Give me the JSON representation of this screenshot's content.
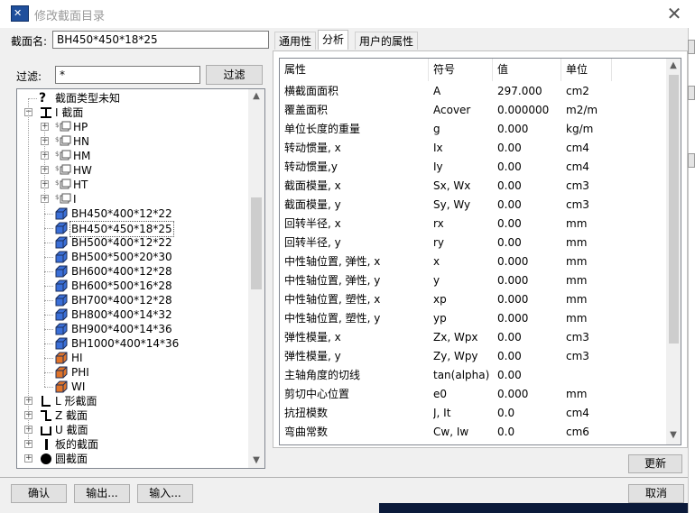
{
  "window": {
    "title": "修改截面目录",
    "close_glyph": "✕",
    "icon": "section-catalog-app-icon"
  },
  "section_name": {
    "label": "截面名:",
    "value": "BH450*450*18*25"
  },
  "filter": {
    "label": "过滤:",
    "value": "*",
    "button": "过滤"
  },
  "tree": {
    "items": [
      {
        "label": "截面类型未知",
        "icon": "question-icon"
      },
      {
        "label": "I 截面",
        "icon": "i-beam-icon",
        "expander": "−"
      },
      {
        "label": "HP",
        "icon": "profile-group-icon",
        "expander": "+"
      },
      {
        "label": "HN",
        "icon": "profile-group-icon",
        "expander": "+"
      },
      {
        "label": "HM",
        "icon": "profile-group-icon",
        "expander": "+"
      },
      {
        "label": "HW",
        "icon": "profile-group-icon",
        "expander": "+"
      },
      {
        "label": "HT",
        "icon": "profile-group-icon",
        "expander": "+"
      },
      {
        "label": "I",
        "icon": "profile-group-icon",
        "expander": "+"
      },
      {
        "label": "BH450*400*12*22",
        "icon": "blue-cube-icon"
      },
      {
        "label": "BH450*450*18*25",
        "icon": "blue-cube-icon",
        "selected": true
      },
      {
        "label": "BH500*400*12*22",
        "icon": "blue-cube-icon"
      },
      {
        "label": "BH500*500*20*30",
        "icon": "blue-cube-icon"
      },
      {
        "label": "BH600*400*12*28",
        "icon": "blue-cube-icon"
      },
      {
        "label": "BH600*500*16*28",
        "icon": "blue-cube-icon"
      },
      {
        "label": "BH700*400*12*28",
        "icon": "blue-cube-icon"
      },
      {
        "label": "BH800*400*14*32",
        "icon": "blue-cube-icon"
      },
      {
        "label": "BH900*400*14*36",
        "icon": "blue-cube-icon"
      },
      {
        "label": "BH1000*400*14*36",
        "icon": "blue-cube-icon"
      },
      {
        "label": "HI",
        "icon": "orange-cube-icon"
      },
      {
        "label": "PHI",
        "icon": "orange-cube-icon"
      },
      {
        "label": "WI",
        "icon": "orange-cube-icon"
      },
      {
        "label": "L 形截面",
        "icon": "l-section-icon",
        "expander": "+"
      },
      {
        "label": "Z 截面",
        "icon": "z-section-icon",
        "expander": "+"
      },
      {
        "label": "U 截面",
        "icon": "u-section-icon",
        "expander": "+"
      },
      {
        "label": "板的截面",
        "icon": "plate-section-icon",
        "expander": "+"
      },
      {
        "label": "圆截面",
        "icon": "round-section-icon",
        "expander": "+"
      }
    ]
  },
  "tabs": [
    {
      "label": "通用性"
    },
    {
      "label": "分析",
      "active": true
    },
    {
      "label": "用户的属性"
    }
  ],
  "grid": {
    "columns": [
      "属性",
      "符号",
      "值",
      "单位"
    ],
    "rows": [
      [
        "横截面面积",
        "A",
        "297.000",
        "cm2"
      ],
      [
        "覆盖面积",
        "Acover",
        "0.000000",
        "m2/m"
      ],
      [
        "单位长度的重量",
        "g",
        "0.000",
        "kg/m"
      ],
      [
        "转动惯量, x",
        "Ix",
        "0.00",
        "cm4"
      ],
      [
        "转动惯量,y",
        "Iy",
        "0.00",
        "cm4"
      ],
      [
        "截面模量, x",
        "Sx, Wx",
        "0.00",
        "cm3"
      ],
      [
        "截面模量, y",
        "Sy, Wy",
        "0.00",
        "cm3"
      ],
      [
        "回转半径, x",
        "rx",
        "0.00",
        "mm"
      ],
      [
        "回转半径, y",
        "ry",
        "0.00",
        "mm"
      ],
      [
        "中性轴位置, 弹性, x",
        "x",
        "0.000",
        "mm"
      ],
      [
        "中性轴位置, 弹性, y",
        "y",
        "0.000",
        "mm"
      ],
      [
        "中性轴位置, 塑性, x",
        "xp",
        "0.000",
        "mm"
      ],
      [
        "中性轴位置, 塑性, y",
        "yp",
        "0.000",
        "mm"
      ],
      [
        "弹性模量, x",
        "Zx, Wpx",
        "0.00",
        "cm3"
      ],
      [
        "弹性模量, y",
        "Zy, Wpy",
        "0.00",
        "cm3"
      ],
      [
        "主轴角度的切线",
        "tan(alpha)",
        "0.00",
        ""
      ],
      [
        "剪切中心位置",
        "e0",
        "0.000",
        "mm"
      ],
      [
        "抗扭模数",
        "J, It",
        "0.0",
        "cm4"
      ],
      [
        "弯曲常数",
        "Cw, Iw",
        "0.0",
        "cm6"
      ]
    ]
  },
  "buttons": {
    "update": "更新",
    "ok": "确认",
    "export": "输出...",
    "import": "输入...",
    "cancel": "取消"
  },
  "colors": {
    "cube_blue": "#3a6fd8",
    "cube_orange": "#e0742a",
    "selection_outline": "#555555"
  }
}
